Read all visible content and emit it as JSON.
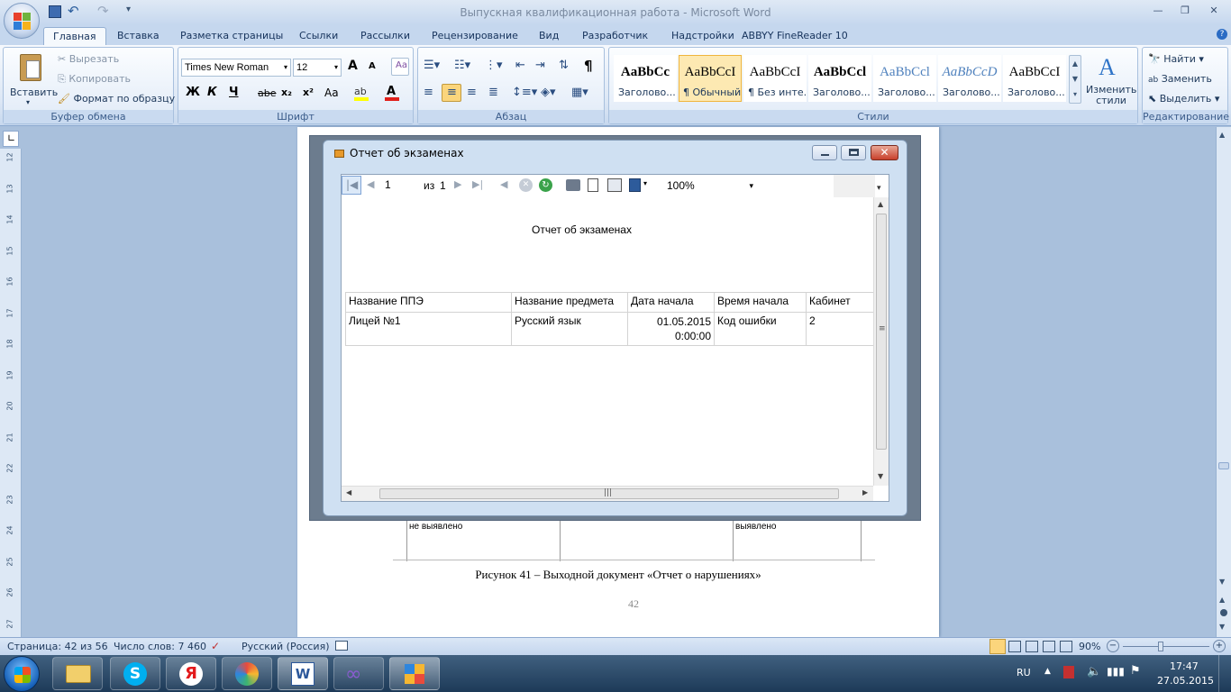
{
  "window": {
    "title": "Выпускная квалификационная работа - Microsoft Word"
  },
  "qat": {
    "undo": "↶",
    "redo": "↷"
  },
  "tabs": [
    "Главная",
    "Вставка",
    "Разметка страницы",
    "Ссылки",
    "Рассылки",
    "Рецензирование",
    "Вид",
    "Разработчик",
    "Надстройки",
    "ABBYY FineReader 10"
  ],
  "clipboard": {
    "paste": "Вставить",
    "cut": "Вырезать",
    "copy": "Копировать",
    "format": "Формат по образцу",
    "label": "Буфер обмена"
  },
  "font": {
    "name": "Times New Roman",
    "size": "12",
    "label": "Шрифт",
    "bold": "Ж",
    "italic": "К",
    "underline": "Ч",
    "strike": "abe",
    "sub": "x₂",
    "sup": "x²",
    "case": "Aa",
    "grow": "A",
    "shrink": "A"
  },
  "paragraph": {
    "label": "Абзац",
    "pilcrow": "¶"
  },
  "styles": {
    "label": "Стили",
    "items": [
      {
        "preview": "AaBbCc",
        "name": "Заголово..."
      },
      {
        "preview": "AaBbCcI",
        "name": "¶ Обычный"
      },
      {
        "preview": "AaBbCcI",
        "name": "¶ Без инте..."
      },
      {
        "preview": "AaBbCcl",
        "name": "Заголово..."
      },
      {
        "preview": "AaBbCcl",
        "name": "Заголово..."
      },
      {
        "preview": "AaBbCcD",
        "name": "Заголово..."
      },
      {
        "preview": "AaBbCcI",
        "name": "Заголово..."
      }
    ],
    "change": "Изменить стили"
  },
  "editing": {
    "find": "Найти",
    "replace": "Заменить",
    "select": "Выделить",
    "label": "Редактирование"
  },
  "ruler_numbers": [
    "12",
    "13",
    "14",
    "15",
    "16",
    "17",
    "18",
    "19",
    "20",
    "21",
    "22",
    "23",
    "24",
    "25",
    "26",
    "27"
  ],
  "document": {
    "behind_left": "не выявлено",
    "behind_right": "выявлено",
    "caption": "Рисунок 41 – Выходной документ «Отчет о нарушениях»",
    "page_number": "42"
  },
  "report_window": {
    "title": "Отчет об экзаменах",
    "page_current": "1",
    "page_of": "из",
    "page_total": "1",
    "zoom": "100%",
    "heading": "Отчет об экзаменах",
    "columns": [
      "Название ППЭ",
      "Название предмета",
      "Дата начала",
      "Время начала",
      "Кабинет"
    ],
    "rows": [
      {
        "ppe": "Лицей №1",
        "subject": "Русский язык",
        "date": "01.05.2015",
        "time_part": "0:00:00",
        "start_time": "Код ошибки",
        "room": "2"
      }
    ]
  },
  "statusbar": {
    "page": "Страница: 42 из 56",
    "words": "Число слов: 7 460",
    "language": "Русский (Россия)",
    "zoom": "90%"
  },
  "tray": {
    "lang": "RU",
    "time": "17:47",
    "date": "27.05.2015"
  },
  "colors": {
    "ribbon_bg": "#dce7f5",
    "accent": "#2b579a",
    "close_red": "#c8402b"
  }
}
